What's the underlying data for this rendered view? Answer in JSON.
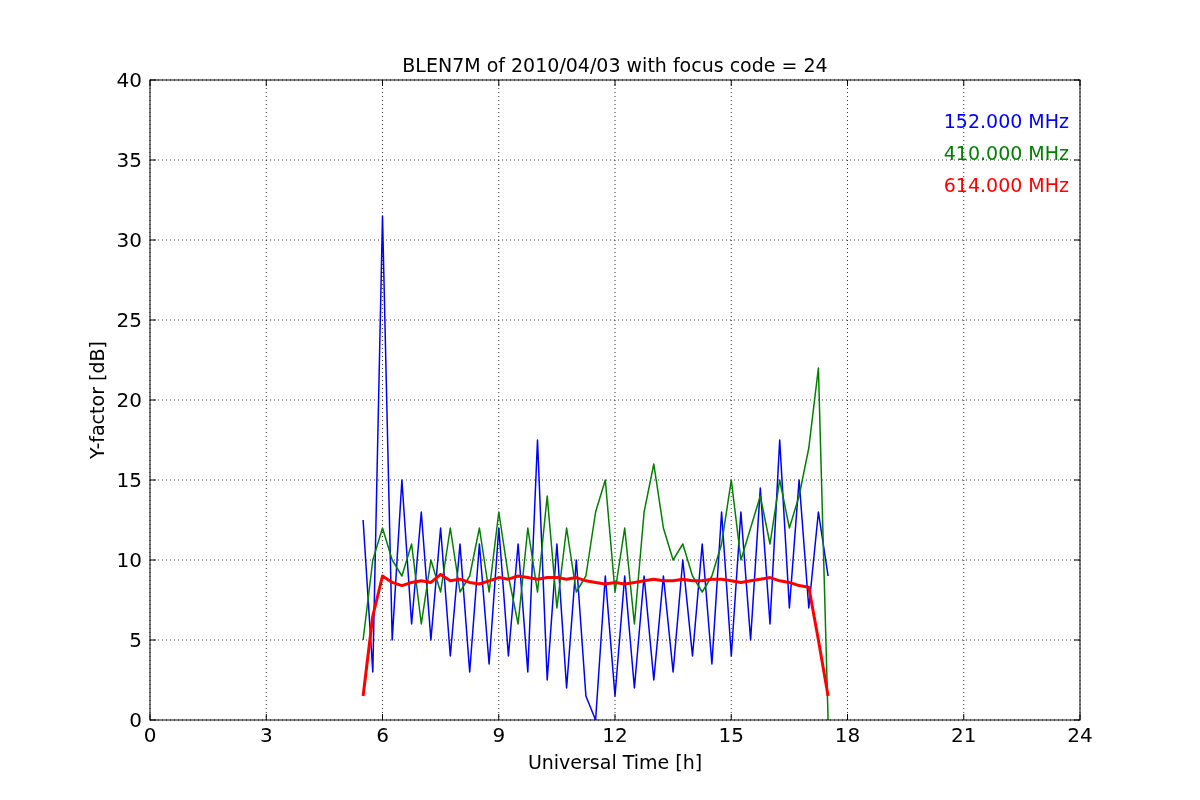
{
  "chart_data": {
    "type": "line",
    "title": "BLEN7M of 2010/04/03 with focus code = 24",
    "xlabel": "Universal Time [h]",
    "ylabel": "Y-factor [dB]",
    "x": [
      5.5,
      5.75,
      6.0,
      6.25,
      6.5,
      6.75,
      7.0,
      7.25,
      7.5,
      7.75,
      8.0,
      8.25,
      8.5,
      8.75,
      9.0,
      9.25,
      9.5,
      9.75,
      10.0,
      10.25,
      10.5,
      10.75,
      11.0,
      11.25,
      11.5,
      11.75,
      12.0,
      12.25,
      12.5,
      12.75,
      13.0,
      13.25,
      13.5,
      13.75,
      14.0,
      14.25,
      14.5,
      14.75,
      15.0,
      15.25,
      15.5,
      15.75,
      16.0,
      16.25,
      16.5,
      16.75,
      17.0,
      17.25,
      17.5
    ],
    "series": [
      {
        "name": "152.000 MHz",
        "color": "#0000ff",
        "values": [
          12.5,
          3,
          31.5,
          5,
          15,
          6,
          13,
          5,
          12,
          4,
          11,
          3,
          11,
          3.5,
          12,
          4,
          11,
          3,
          17.5,
          2.5,
          11,
          2,
          10,
          1.5,
          0,
          9,
          1.5,
          9,
          2,
          9,
          2.5,
          9,
          3,
          10,
          4,
          11,
          3.5,
          13,
          4,
          13,
          5,
          14.5,
          6,
          17.5,
          7,
          15,
          7,
          13,
          9
        ]
      },
      {
        "name": "410.000 MHz",
        "color": "#008000",
        "values": [
          5,
          10,
          12,
          10,
          9,
          11,
          6,
          10,
          8,
          12,
          8,
          9,
          12,
          8,
          13,
          9,
          6,
          12,
          8,
          14,
          7,
          12,
          8,
          9,
          13,
          15,
          8,
          12,
          6,
          13,
          16,
          12,
          10,
          11,
          9,
          8,
          9,
          11,
          15,
          10,
          12,
          14,
          11,
          15,
          12,
          14,
          17,
          22,
          0
        ]
      },
      {
        "name": "614.000 MHz",
        "color": "#ff0000",
        "values": [
          1.5,
          6.5,
          9,
          8.6,
          8.4,
          8.6,
          8.7,
          8.6,
          9.1,
          8.7,
          8.8,
          8.6,
          8.5,
          8.7,
          8.9,
          8.8,
          9.0,
          8.9,
          8.8,
          8.9,
          8.9,
          8.8,
          8.9,
          8.7,
          8.6,
          8.5,
          8.6,
          8.5,
          8.6,
          8.7,
          8.8,
          8.7,
          8.7,
          8.8,
          8.7,
          8.7,
          8.8,
          8.8,
          8.7,
          8.6,
          8.7,
          8.8,
          8.9,
          8.7,
          8.6,
          8.4,
          8.3,
          5,
          1.5
        ]
      }
    ],
    "grid": true,
    "xlim": [
      0,
      24
    ],
    "ylim": [
      0,
      40
    ],
    "xticks": [
      0,
      3,
      6,
      9,
      12,
      15,
      18,
      21,
      24
    ],
    "yticks": [
      0,
      5,
      10,
      15,
      20,
      25,
      30,
      35,
      40
    ]
  }
}
